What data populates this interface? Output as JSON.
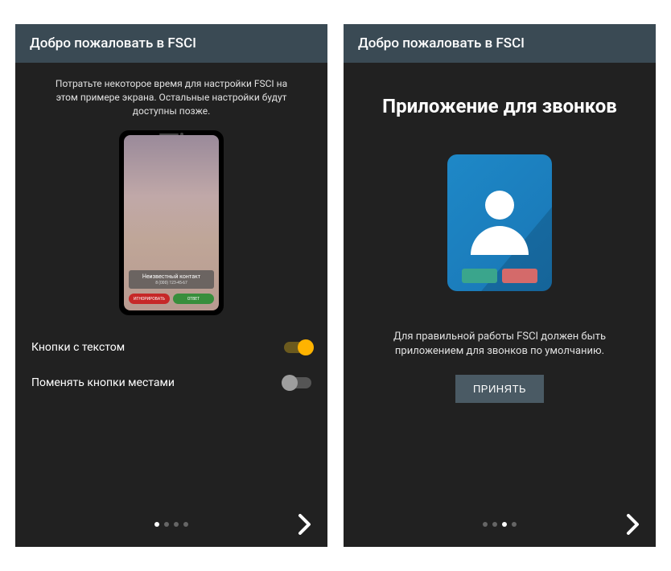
{
  "left": {
    "header": "Добро пожаловать в FSCI",
    "intro": "Потратьте некоторое время для настройки FSCI на этом примере экрана. Остальные настройки будут доступны позже.",
    "mock": {
      "contact_label": "Неизвестный контакт",
      "contact_sub": "8 (000) 123-45-67",
      "decline": "ИГНОРИРОВАТЬ",
      "accept": "ОТВЕТ"
    },
    "settings": {
      "text_buttons": "Кнопки с текстом",
      "swap_buttons": "Поменять кнопки местами"
    },
    "page_index": 0,
    "page_count": 4
  },
  "right": {
    "header": "Добро пожаловать в FSCI",
    "title": "Приложение для звонков",
    "description": "Для правильной работы FSCI должен быть приложением для звонков по умолчанию.",
    "accept_label": "ПРИНЯТЬ",
    "page_index": 2,
    "page_count": 4
  }
}
